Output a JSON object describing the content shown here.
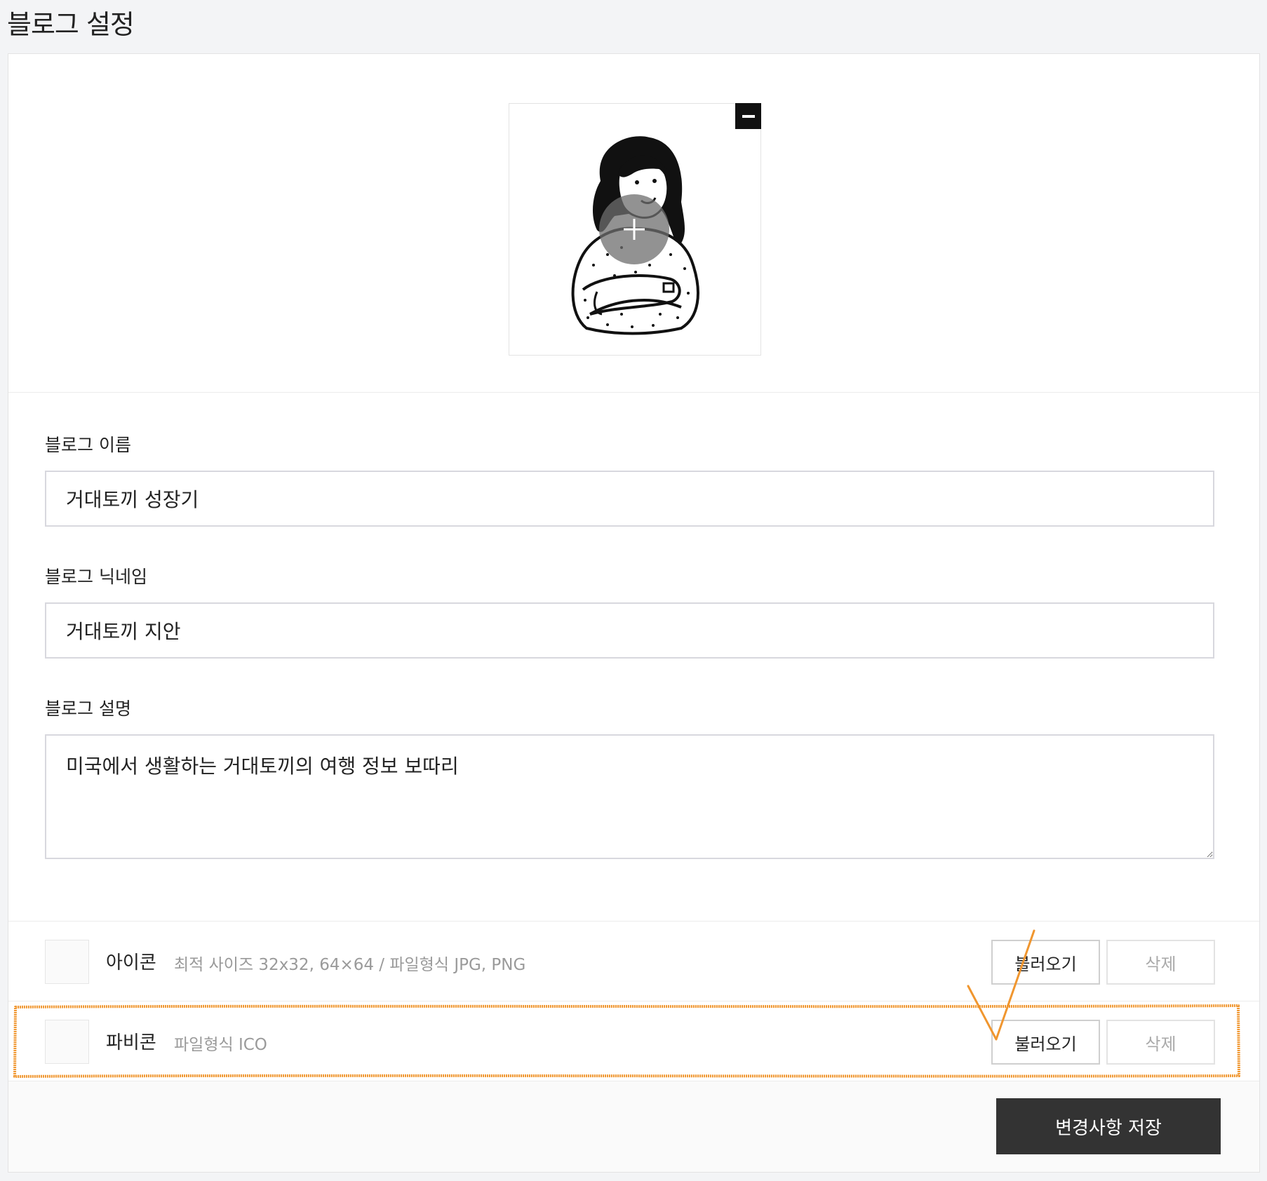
{
  "page": {
    "title": "블로그 설정"
  },
  "profile": {
    "remove_icon": "minus-icon",
    "add_icon": "plus-icon"
  },
  "form": {
    "name": {
      "label": "블로그 이름",
      "value": "거대토끼 성장기"
    },
    "nickname": {
      "label": "블로그 닉네임",
      "value": "거대토끼 지안"
    },
    "description": {
      "label": "블로그 설명",
      "value": "미국에서 생활하는 거대토끼의 여행 정보 보따리"
    }
  },
  "files": [
    {
      "name": "아이콘",
      "desc": "최적 사이즈 32x32, 64×64 / 파일형식 JPG, PNG",
      "load_label": "불러오기",
      "delete_label": "삭제"
    },
    {
      "name": "파비콘",
      "desc": "파일형식 ICO",
      "load_label": "불러오기",
      "delete_label": "삭제"
    }
  ],
  "footer": {
    "save_label": "변경사항 저장"
  },
  "colors": {
    "highlight": "#f0962f",
    "save_button": "#333333"
  }
}
